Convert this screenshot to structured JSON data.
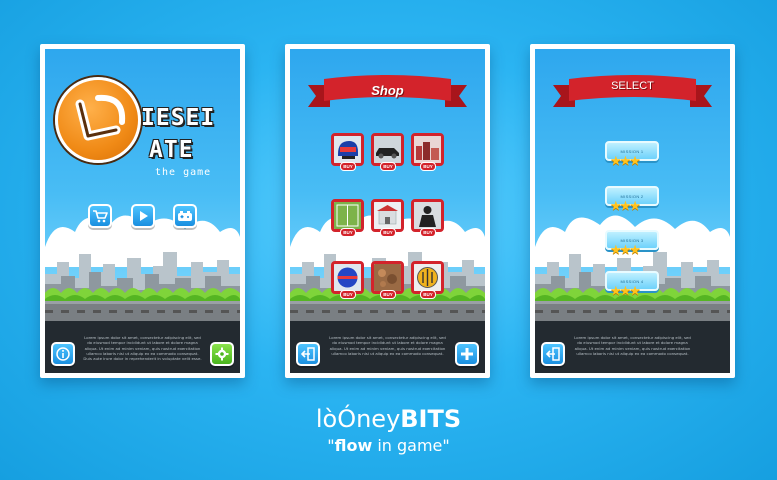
{
  "screens": [
    {
      "id": "main-menu",
      "logo_word_1": "IESEI",
      "logo_word_2": "ATE",
      "logo_subtitle": "the game",
      "menu_buttons": [
        {
          "icon": "cart-icon"
        },
        {
          "icon": "play-icon"
        },
        {
          "icon": "gamepad-icon"
        }
      ],
      "info_button_icon": "info-icon",
      "settings_button_icon": "gear-icon",
      "description": "Lorem ipsum dolor sit amet, consectetur adipiscing elit, sed do eiusmod tempor incididunt ut labore et dolore magna aliqua. Ut enim ad minim veniam, quis nostrud exercitation ullamco laboris nisi ut aliquip ex ea commodo consequat. Duis aute irure dolor in reprehenderit in voluptate velit esse."
    },
    {
      "id": "shop",
      "title": "Shop",
      "item_tag": "BUY",
      "items": [
        {
          "kind": "helmet"
        },
        {
          "kind": "car"
        },
        {
          "kind": "city"
        },
        {
          "kind": "field"
        },
        {
          "kind": "building"
        },
        {
          "kind": "figure"
        },
        {
          "kind": "ball"
        },
        {
          "kind": "rocks"
        },
        {
          "kind": "grid"
        }
      ],
      "back_button_icon": "exit-icon",
      "add_button_icon": "plus-icon",
      "description": "Lorem ipsum dolor sit amet, consectetur adipiscing elit, sed do eiusmod tempor incididunt ut labore et dolore magna aliqua. Ut enim ad minim veniam, quis nostrud exercitation ullamco laboris nisi ut aliquip ex ea commodo consequat."
    },
    {
      "id": "select",
      "title": "SELECT",
      "levels": [
        {
          "label": "MISSION 1",
          "stars": 3
        },
        {
          "label": "MISSION 2",
          "stars": 3
        },
        {
          "label": "MISSION 3",
          "stars": 3
        },
        {
          "label": "MISSION 4",
          "stars": 3
        }
      ],
      "back_button_icon": "exit-icon",
      "description": "Lorem ipsum dolor sit amet, consectetur adipiscing elit, sed do eiusmod tempor incididunt ut labore et dolore magna aliqua. Ut enim ad minim veniam, quis nostrud exercitation ullamco laboris nisi ut aliquip ex ea commodo consequat."
    }
  ],
  "brand": {
    "name_part_1": "lòÓney",
    "name_part_2": "BITS",
    "tagline_open": "\"",
    "tagline_bold": "flow",
    "tagline_rest": " in game\""
  },
  "colors": {
    "background": "#2bb4f2",
    "ribbon_red": "#d3232b",
    "logo_orange": "#f08a16",
    "button_blue": "#1a8fe0",
    "button_green": "#4ab51e",
    "star_gold": "#ffc31f"
  }
}
